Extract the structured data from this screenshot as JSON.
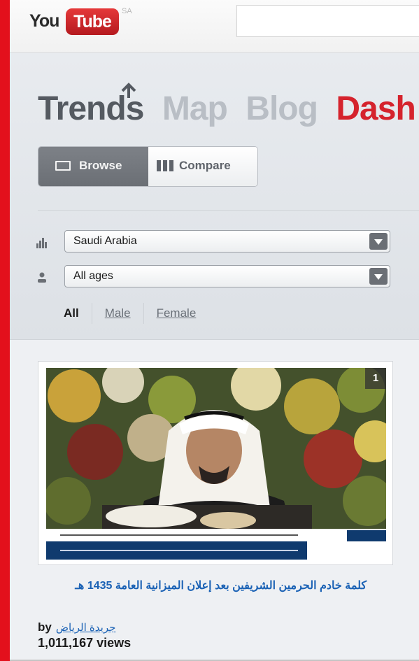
{
  "header": {
    "logo_you": "You",
    "logo_tube": "Tube",
    "region": "SA",
    "search_value": ""
  },
  "nav": {
    "items": [
      {
        "label": "Trends"
      },
      {
        "label": "Map"
      },
      {
        "label": "Blog"
      },
      {
        "label": "Dash"
      }
    ],
    "active": "Trends"
  },
  "view_toggle": {
    "browse_label": "Browse",
    "compare_label": "Compare",
    "selected": "Browse"
  },
  "filters": {
    "country": "Saudi Arabia",
    "age": "All ages",
    "gender_tabs": [
      "All",
      "Male",
      "Female"
    ],
    "gender_selected": "All"
  },
  "video": {
    "rank": "1",
    "title": "كلمة خادم الحرمين الشريفين بعد إعلان الميزانية العامة 1435 هـ",
    "by_prefix": "by",
    "channel": "جريدة الرياض",
    "views": "1,011,167 views"
  },
  "colors": {
    "brand_red": "#e3101c",
    "link_blue": "#1b62b5",
    "active_tab_gray": "#6b6f75"
  },
  "icons": {
    "country": "bar-chart-icon",
    "age": "person-icon",
    "browse": "browse-window-icon",
    "compare": "compare-columns-icon",
    "select": "chevron-down-icon"
  }
}
